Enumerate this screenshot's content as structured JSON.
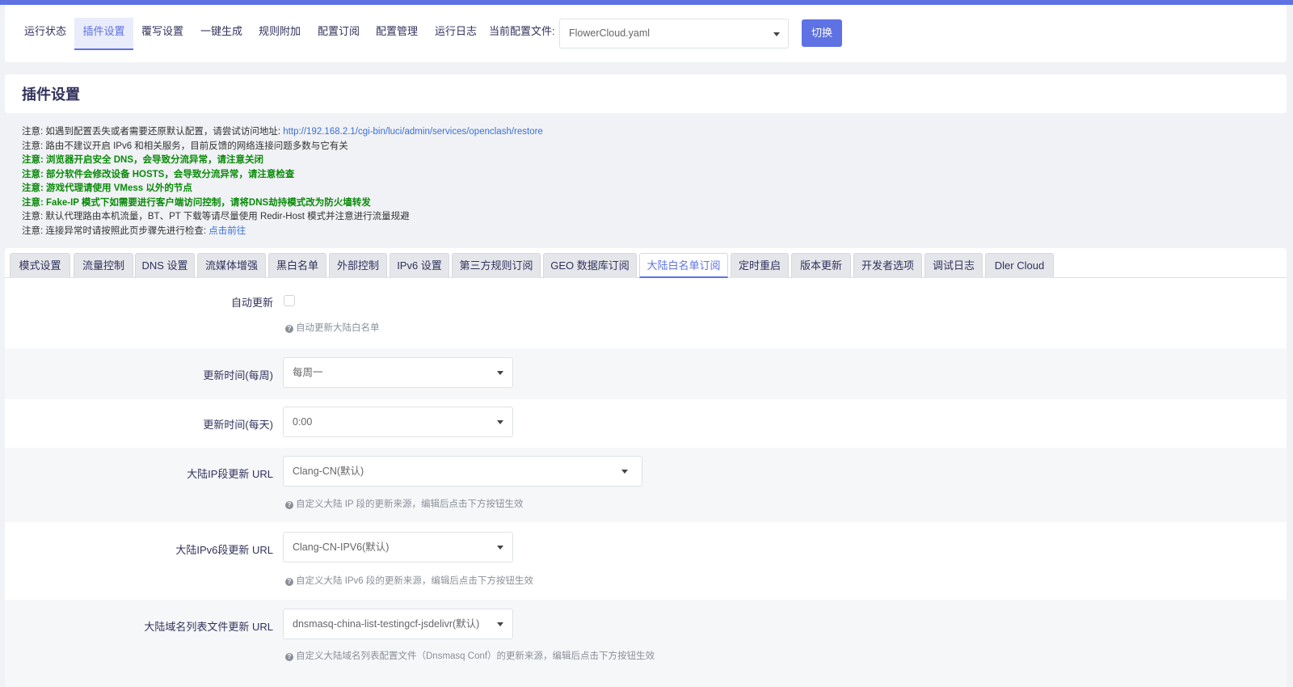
{
  "nav": {
    "items": [
      "运行状态",
      "插件设置",
      "覆写设置",
      "一键生成",
      "规则附加",
      "配置订阅",
      "配置管理",
      "运行日志"
    ],
    "config_label": "当前配置文件:",
    "config_value": "FlowerCloud.yaml",
    "switch_label": "切换"
  },
  "page": {
    "title": "插件设置"
  },
  "notes": {
    "n1_prefix": "注意: 如遇到配置丢失或者需要还原默认配置，请尝试访问地址: ",
    "n1_link": "http://192.168.2.1/cgi-bin/luci/admin/services/openclash/restore",
    "n2": "注意: 路由不建议开启 IPv6 和相关服务，目前反馈的网络连接问题多数与它有关",
    "n3": "注意: 浏览器开启安全 DNS，会导致分流异常，请注意关闭",
    "n4": "注意: 部分软件会修改设备 HOSTS，会导致分流异常，请注意检查",
    "n5": "注意: 游戏代理请使用 VMess 以外的节点",
    "n6": "注意: Fake-IP 模式下如需要进行客户端访问控制，请将DNS劫持模式改为防火墙转发",
    "n7": "注意: 默认代理路由本机流量，BT、PT 下载等请尽量使用 Redir-Host 模式并注意进行流量规避",
    "n8_prefix": "注意: 连接异常时请按照此页步骤先进行检查: ",
    "n8_link": "点击前往"
  },
  "tabs": [
    "模式设置",
    "流量控制",
    "DNS 设置",
    "流媒体增强",
    "黑白名单",
    "外部控制",
    "IPv6 设置",
    "第三方规则订阅",
    "GEO 数据库订阅",
    "大陆白名单订阅",
    "定时重启",
    "版本更新",
    "开发者选项",
    "调试日志",
    "Dler Cloud"
  ],
  "form": {
    "auto_update": {
      "label": "自动更新",
      "hint": "自动更新大陆白名单",
      "checked": false
    },
    "weekly": {
      "label": "更新时间(每周)",
      "value": "每周一"
    },
    "daily": {
      "label": "更新时间(每天)",
      "value": "0:00"
    },
    "ip_url": {
      "label": "大陆IP段更新 URL",
      "value": "Clang-CN(默认)",
      "hint": "自定义大陆 IP 段的更新来源，编辑后点击下方按钮生效"
    },
    "ipv6_url": {
      "label": "大陆IPv6段更新 URL",
      "value": "Clang-CN-IPV6(默认)",
      "hint": "自定义大陆 IPv6 段的更新来源，编辑后点击下方按钮生效"
    },
    "domain_url": {
      "label": "大陆域名列表文件更新 URL",
      "value": "dnsmasq-china-list-testingcf-jsdelivr(默认)",
      "hint": "自定义大陆域名列表配置文件（Dnsmasq Conf）的更新来源，编辑后点击下方按钮生效"
    }
  },
  "colors": {
    "accent": "#5e72e4",
    "note_green": "#0a8a0a",
    "link": "#3b6fd8"
  },
  "icons": {
    "select_caret": "chevron-down-icon",
    "hint": "question-circle-icon"
  }
}
